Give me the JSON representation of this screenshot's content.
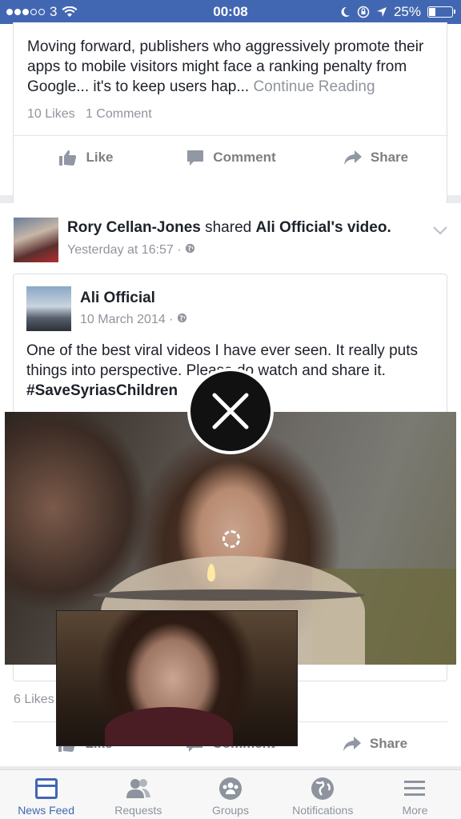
{
  "status": {
    "carrier": "3",
    "time": "00:08",
    "battery": "25%"
  },
  "post1": {
    "text": "Moving forward, publishers who aggressively promote their apps to mobile visitors might face a ranking penalty from Google... it's to keep users hap...",
    "continue": "Continue Reading",
    "likes": "10 Likes",
    "comments": "1 Comment"
  },
  "actions": {
    "like": "Like",
    "comment": "Comment",
    "share": "Share"
  },
  "post2": {
    "sharer": "Rory Cellan-Jones",
    "shared_word": "shared",
    "original": "Ali Official",
    "possessive": "'s video.",
    "time": "Yesterday at 16:57 ·",
    "inner_author": "Ali Official",
    "inner_date": "10 March 2014 ·",
    "text": "One of the best viral videos I have ever seen. It really puts things into perspective. Please do watch and share it.",
    "hashtag": "#SaveSyriasChildren",
    "likes": "6 Likes"
  },
  "tabs": [
    {
      "label": "News Feed",
      "icon": "news-feed-icon",
      "active": true
    },
    {
      "label": "Requests",
      "icon": "requests-icon"
    },
    {
      "label": "Groups",
      "icon": "groups-icon"
    },
    {
      "label": "Notifications",
      "icon": "globe-icon"
    },
    {
      "label": "More",
      "icon": "menu-icon"
    }
  ],
  "colors": {
    "brand": "#4267b2",
    "muted": "#90949c"
  }
}
